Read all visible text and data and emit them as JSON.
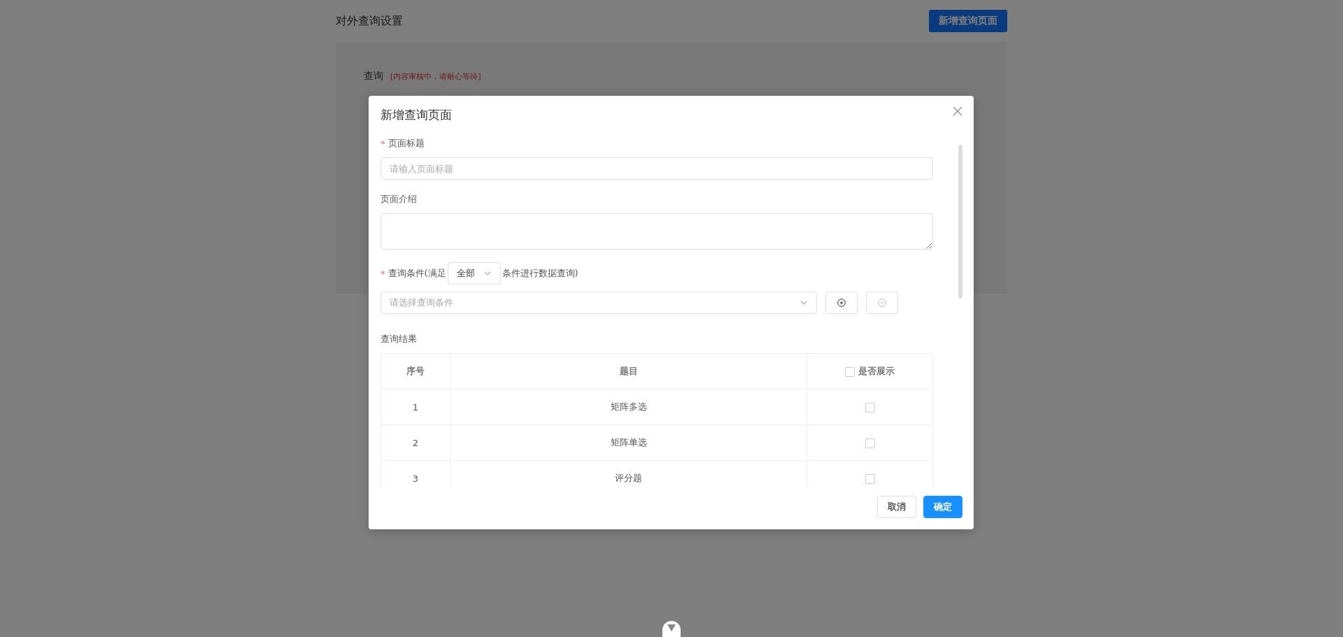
{
  "page": {
    "title": "对外查询设置",
    "add_button": "新增查询页面",
    "section_label": "查询",
    "review_status": "[内容审核中，请耐心等待]"
  },
  "modal": {
    "title": "新增查询页面",
    "required_mark": "*",
    "title_field": {
      "label": "页面标题",
      "required": true,
      "placeholder": "请输入页面标题"
    },
    "intro_field": {
      "label": "页面介绍",
      "required": false
    },
    "condition": {
      "required": true,
      "label_before": "查询条件(满足",
      "match_value": "全部",
      "label_after": "条件进行数据查询)",
      "placeholder": "请选择查询条件",
      "remove_disabled": true
    },
    "results": {
      "label": "查询结果",
      "columns": [
        "序号",
        "题目",
        "是否展示"
      ],
      "show_all_checked": false,
      "rows": [
        {
          "index": "1",
          "question": "矩阵多选",
          "checked": false
        },
        {
          "index": "2",
          "question": "矩阵单选",
          "checked": false
        },
        {
          "index": "3",
          "question": "评分题",
          "checked": false
        }
      ]
    },
    "buttons": {
      "cancel": "取消",
      "ok": "确定"
    }
  }
}
